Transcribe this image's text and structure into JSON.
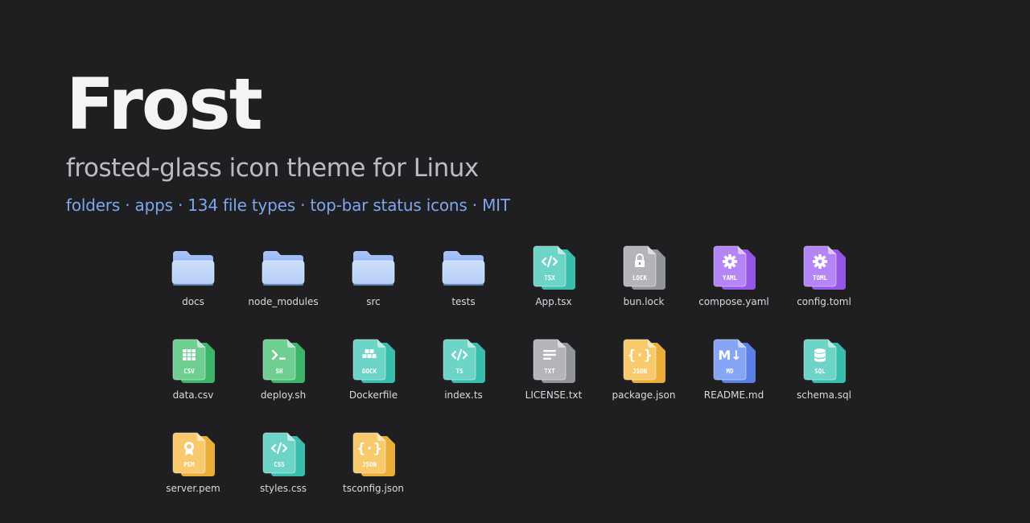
{
  "hero": {
    "title": "Frost",
    "subtitle": "frosted-glass icon theme for Linux",
    "tagline": "folders · apps · 134 file types · top-bar status icons · MIT"
  },
  "colors": {
    "background": "#1f1f21",
    "folder": "#8fb3f7",
    "teal": "#3cc7b6",
    "gray": "#9a9ca3",
    "purple": "#9b5cf0",
    "green": "#3fbf6e",
    "orange": "#f6b73c",
    "blue": "#5f87f2",
    "tagline": "#7ea6ef"
  },
  "items": [
    {
      "name": "docs",
      "kind": "folder",
      "color": "#8fb3f7"
    },
    {
      "name": "node_modules",
      "kind": "folder",
      "color": "#8fb3f7"
    },
    {
      "name": "src",
      "kind": "folder",
      "color": "#8fb3f7"
    },
    {
      "name": "tests",
      "kind": "folder",
      "color": "#8fb3f7"
    },
    {
      "name": "App.tsx",
      "kind": "file",
      "badge": "TSX",
      "glyph": "code-icon",
      "color": "#3cc7b6"
    },
    {
      "name": "bun.lock",
      "kind": "file",
      "badge": "LOCK",
      "glyph": "lock-icon",
      "color": "#9a9ca3"
    },
    {
      "name": "compose.yaml",
      "kind": "file",
      "badge": "YAML",
      "glyph": "gear-icon",
      "color": "#9b5cf0"
    },
    {
      "name": "config.toml",
      "kind": "file",
      "badge": "TOML",
      "glyph": "gear-icon",
      "color": "#9b5cf0"
    },
    {
      "name": "data.csv",
      "kind": "file",
      "badge": "CSV",
      "glyph": "table-icon",
      "color": "#3fbf6e"
    },
    {
      "name": "deploy.sh",
      "kind": "file",
      "badge": "SH",
      "glyph": "terminal-icon",
      "color": "#3fbf6e"
    },
    {
      "name": "Dockerfile",
      "kind": "file",
      "badge": "DOCK",
      "glyph": "container-icon",
      "color": "#3cc7b6"
    },
    {
      "name": "index.ts",
      "kind": "file",
      "badge": "TS",
      "glyph": "code-icon",
      "color": "#3cc7b6"
    },
    {
      "name": "LICENSE.txt",
      "kind": "file",
      "badge": "TXT",
      "glyph": "text-lines-icon",
      "color": "#9a9ca3"
    },
    {
      "name": "package.json",
      "kind": "file",
      "badge": "JSON",
      "glyph": "braces-icon",
      "color": "#f6b73c"
    },
    {
      "name": "README.md",
      "kind": "file",
      "badge": "MD",
      "glyph": "markdown-icon",
      "color": "#5f87f2"
    },
    {
      "name": "schema.sql",
      "kind": "file",
      "badge": "SQL",
      "glyph": "database-icon",
      "color": "#3cc7b6"
    },
    {
      "name": "server.pem",
      "kind": "file",
      "badge": "PEM",
      "glyph": "certificate-icon",
      "color": "#f6b73c"
    },
    {
      "name": "styles.css",
      "kind": "file",
      "badge": "CSS",
      "glyph": "code-icon",
      "color": "#3cc7b6"
    },
    {
      "name": "tsconfig.json",
      "kind": "file",
      "badge": "JSON",
      "glyph": "braces-icon",
      "color": "#f6b73c"
    }
  ]
}
